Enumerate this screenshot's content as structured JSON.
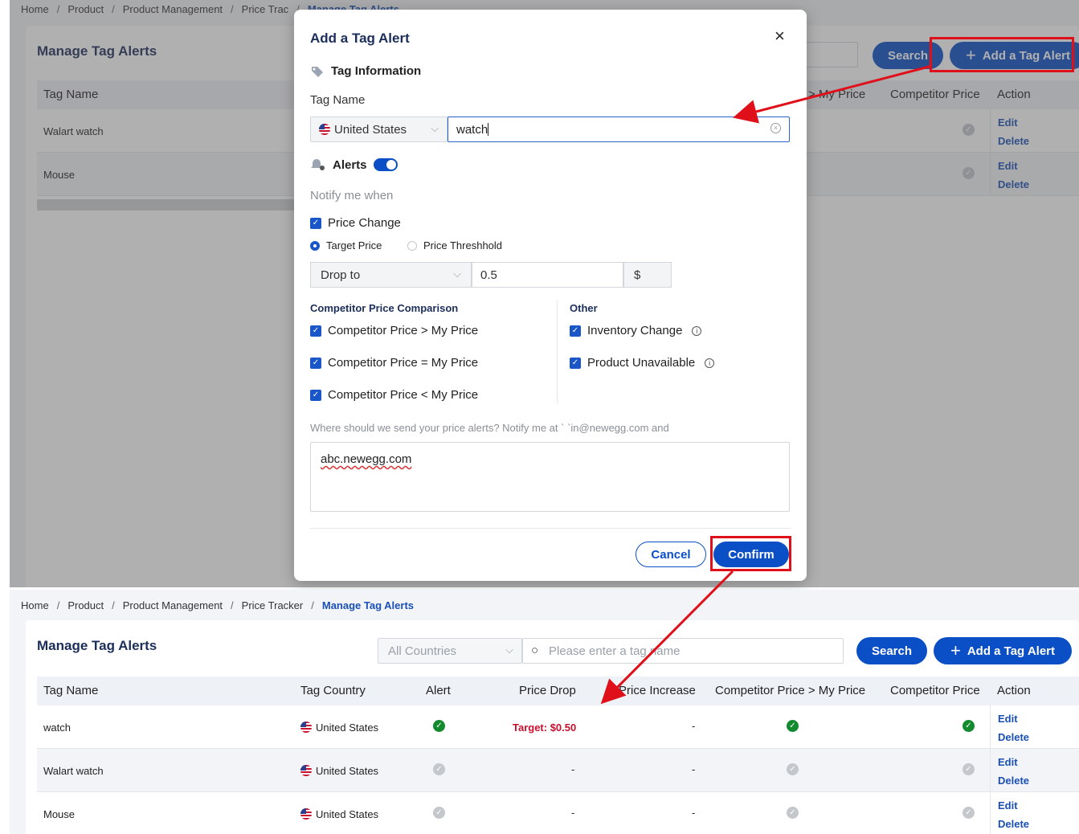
{
  "breadcrumb": {
    "items": [
      "Home",
      "Product",
      "Product Management",
      "Price Tracker"
    ],
    "current": "Manage Tag Alerts",
    "top_partial": "Price Trac",
    "top_current_partial": "Manage Tag Alerts"
  },
  "page": {
    "title": "Manage Tag Alerts",
    "country_filter": "All Countries",
    "search_placeholder": "Please enter a tag name",
    "search_label": "Search",
    "add_label": "Add a Tag Alert"
  },
  "table": {
    "headers": [
      "Tag Name",
      "Tag Country",
      "Alert",
      "Price Drop",
      "Price Increase",
      "Competitor Price > My Price",
      "Competitor Price",
      "Action"
    ],
    "top_headers": [
      "Tag Name",
      "> My Price",
      "Competitor Price",
      "Action"
    ],
    "rows": [
      {
        "name": "watch",
        "country": "United States",
        "alert": true,
        "price_drop": "Target: $0.50",
        "price_increase": "-",
        "cp_gt": true,
        "cp": true,
        "edit": "Edit",
        "delete": "Delete"
      },
      {
        "name": "Walart watch",
        "country": "United States",
        "alert": false,
        "price_drop": "-",
        "price_increase": "-",
        "cp_gt": false,
        "cp": false,
        "edit": "Edit",
        "delete": "Delete"
      },
      {
        "name": "Mouse",
        "country": "United States",
        "alert": false,
        "price_drop": "-",
        "price_increase": "-",
        "cp_gt": false,
        "cp": false,
        "edit": "Edit",
        "delete": "Delete"
      }
    ]
  },
  "modal": {
    "title": "Add a Tag Alert",
    "close": "×",
    "tag_info": "Tag Information",
    "tag_name_label": "Tag Name",
    "country": "United States",
    "tag_name_value": "watch",
    "alerts_label": "Alerts",
    "notify_label": "Notify me when",
    "price_change": "Price Change",
    "target_price": "Target Price",
    "price_threshold": "Price Threshhold",
    "drop_select": "Drop to",
    "price_value": "0.5",
    "currency": "$",
    "comp_title": "Competitor Price Comparison",
    "comp_gt": "Competitor Price > My Price",
    "comp_eq": "Competitor Price = My Price",
    "comp_lt": "Competitor Price < My Price",
    "other_title": "Other",
    "inventory_change": "Inventory Change",
    "product_unavailable": "Product Unavailable",
    "where_text": "Where should we send your price alerts?   Notify me at `           `in@newegg.com and",
    "email_value": "abc.newegg.com",
    "cancel": "Cancel",
    "confirm": "Confirm"
  },
  "colors": {
    "primary": "#0b4fc6",
    "highlight": "#e0101a",
    "success": "#138a2e",
    "target": "#c8102e"
  }
}
